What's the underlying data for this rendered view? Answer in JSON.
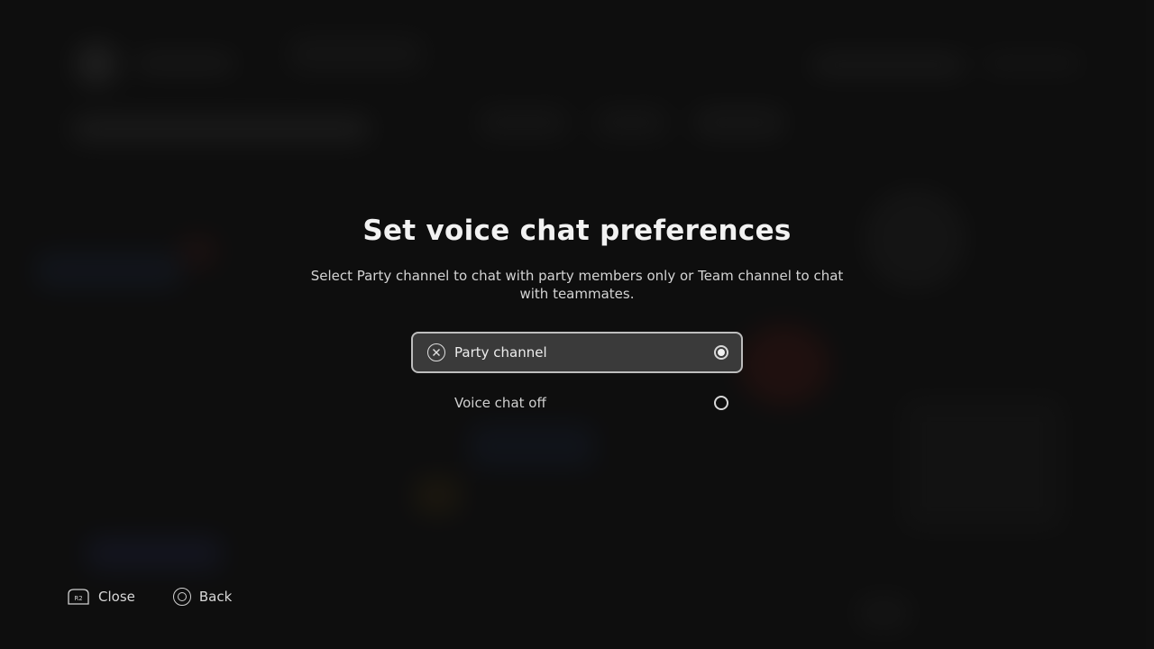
{
  "dialog": {
    "title": "Set voice chat preferences",
    "subtitle": "Select Party channel to chat with party members only or Team channel to chat with teammates."
  },
  "options": [
    {
      "label": "Party channel",
      "selected": true,
      "confirm_icon": "cross-button-icon"
    },
    {
      "label": "Voice chat off",
      "selected": false
    }
  ],
  "footer": {
    "close_label": "Close",
    "close_icon": "r2-button-icon",
    "close_icon_text": "R2",
    "back_label": "Back",
    "back_icon": "circle-button-icon"
  },
  "colors": {
    "background": "#151515",
    "selected_row": "#3a3a3a",
    "selected_border": "#bdbdbd",
    "text": "#f2f2f2"
  }
}
